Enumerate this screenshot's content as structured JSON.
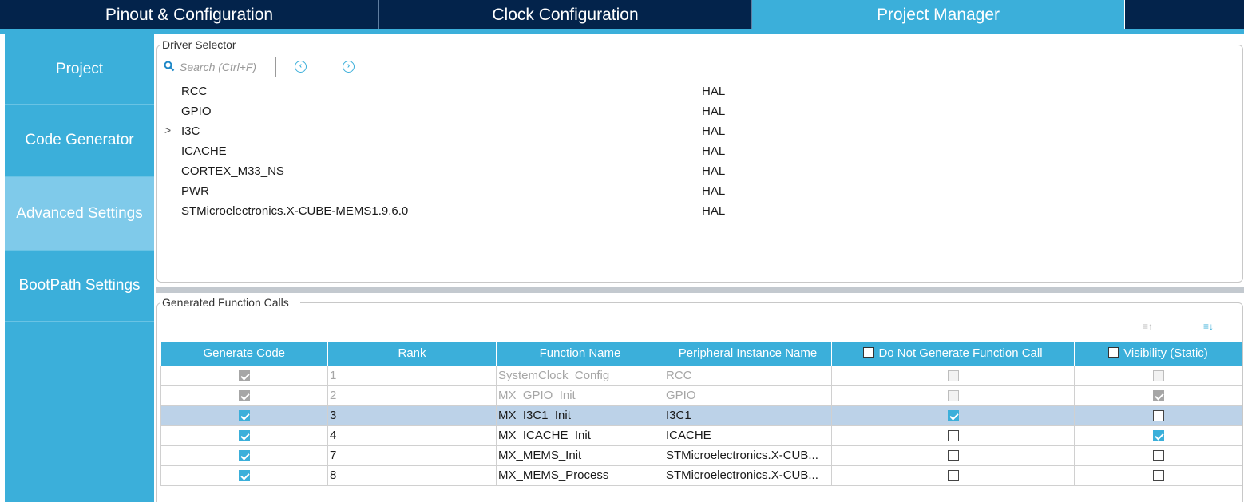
{
  "top_tabs": [
    "Pinout & Configuration",
    "Clock Configuration",
    "Project Manager"
  ],
  "sidebar": [
    "Project",
    "Code Generator",
    "Advanced Settings",
    "BootPath Settings"
  ],
  "driver_selector": {
    "title": "Driver Selector",
    "search_placeholder": "Search (Ctrl+F)",
    "drivers": [
      {
        "name": "RCC",
        "driver": "HAL"
      },
      {
        "name": "GPIO",
        "driver": "HAL"
      },
      {
        "name": "I3C",
        "driver": "HAL",
        "expandable": true,
        "chevron": ">"
      },
      {
        "name": "ICACHE",
        "driver": "HAL"
      },
      {
        "name": "CORTEX_M33_NS",
        "driver": "HAL"
      },
      {
        "name": "PWR",
        "driver": "HAL"
      },
      {
        "name": "STMicroelectronics.X-CUBE-MEMS1.9.6.0",
        "driver": "HAL"
      }
    ]
  },
  "function_calls": {
    "title": "Generated Function Calls",
    "columns": [
      "Generate Code",
      "Rank",
      "Function Name",
      "Peripheral Instance Name",
      "Do Not Generate Function Call",
      "Visibility (Static)"
    ],
    "rows": [
      {
        "generate": true,
        "rank": "1",
        "function": "SystemClock_Config",
        "instance": "RCC",
        "no_call": false,
        "static": false,
        "disabled": true,
        "selected": false
      },
      {
        "generate": true,
        "rank": "2",
        "function": "MX_GPIO_Init",
        "instance": "GPIO",
        "no_call": false,
        "static": true,
        "disabled": true,
        "selected": false
      },
      {
        "generate": true,
        "rank": "3",
        "function": "MX_I3C1_Init",
        "instance": "I3C1",
        "no_call": true,
        "static": false,
        "disabled": false,
        "selected": true
      },
      {
        "generate": true,
        "rank": "4",
        "function": "MX_ICACHE_Init",
        "instance": "ICACHE",
        "no_call": false,
        "static": true,
        "disabled": false,
        "selected": false
      },
      {
        "generate": true,
        "rank": "7",
        "function": "MX_MEMS_Init",
        "instance": "STMicroelectronics.X-CUB...",
        "no_call": false,
        "static": false,
        "disabled": false,
        "selected": false
      },
      {
        "generate": true,
        "rank": "8",
        "function": "MX_MEMS_Process",
        "instance": "STMicroelectronics.X-CUB...",
        "no_call": false,
        "static": false,
        "disabled": false,
        "selected": false
      }
    ]
  },
  "colors": {
    "header_dark": "#03234b",
    "accent": "#3bafda",
    "selected_row": "#bcd2e8"
  }
}
